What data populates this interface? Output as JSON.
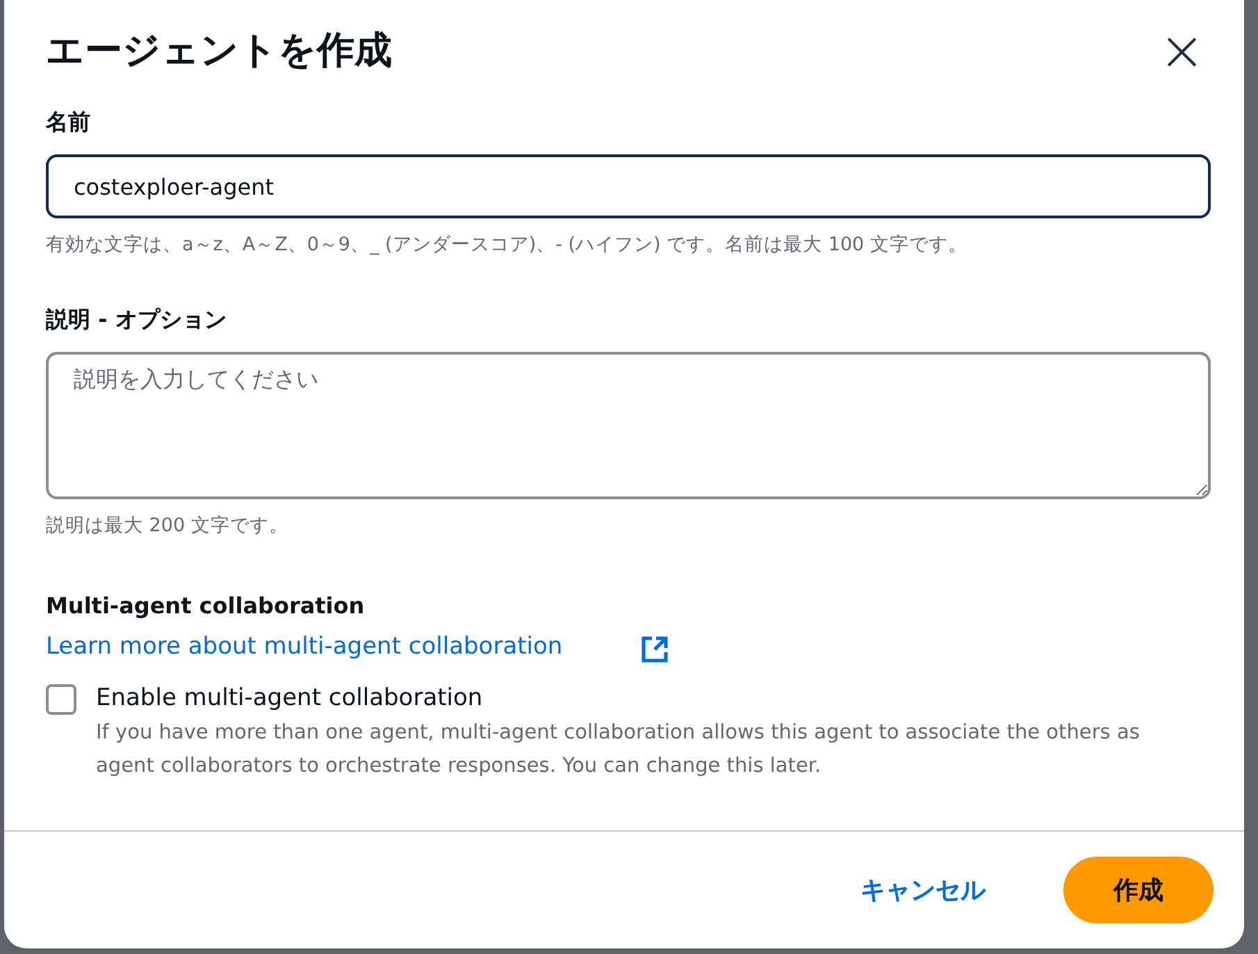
{
  "dialog": {
    "title": "エージェントを作成",
    "close": "×"
  },
  "name_field": {
    "label": "名前",
    "value": "costexploer-agent",
    "hint": "有効な文字は、a～z、A～Z、0～9、_ (アンダースコア)、- (ハイフン) です。名前は最大 100 文字です。"
  },
  "description_field": {
    "label": "説明 - オプション",
    "placeholder": "説明を入力してください",
    "hint": "説明は最大 200 文字です。"
  },
  "collaboration": {
    "heading": "Multi-agent collaboration",
    "link": "Learn more about multi-agent collaboration",
    "checkbox": {
      "label": "Enable multi-agent collaboration",
      "checked": false,
      "description": "If you have more than one agent, multi-agent collaboration allows this agent to associate the others as agent collaborators to orchestrate responses. You can change this later."
    }
  },
  "buttons": [
    {
      "kind": "link",
      "label": "キャンセル"
    },
    {
      "kind": "primary",
      "label": "作成"
    }
  ]
}
